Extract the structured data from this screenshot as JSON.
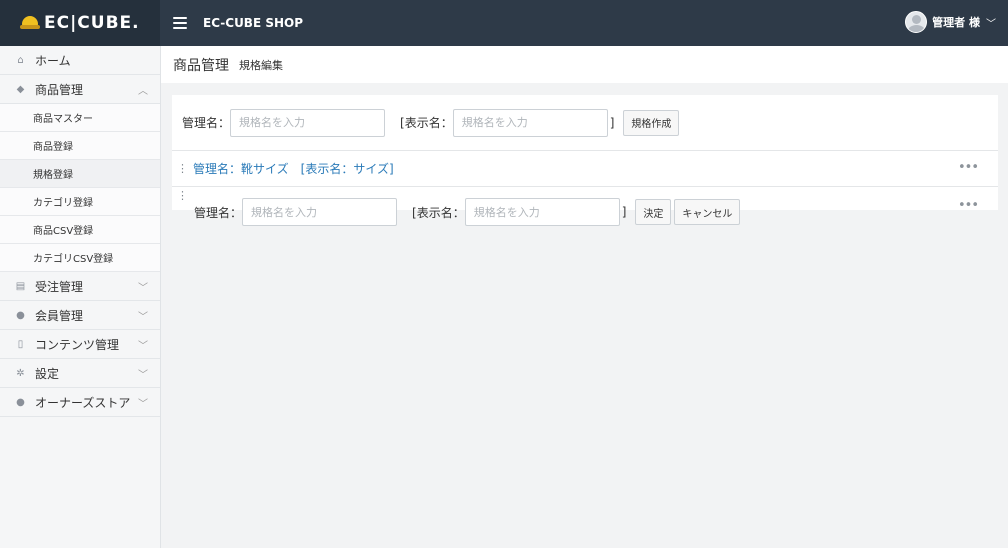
{
  "header": {
    "logo_text": "EC|CUBE.",
    "shop_name": "EC-CUBE SHOP",
    "user_name": "管理者 様",
    "user_chevron": "﹀"
  },
  "sidebar": {
    "items": [
      {
        "label": "ホーム",
        "icon": "home-icon",
        "glyph": "⌂"
      },
      {
        "label": "商品管理",
        "icon": "tag-icon",
        "glyph": "◆",
        "chevron": "︿"
      },
      {
        "label": "受注管理",
        "icon": "cart-icon",
        "glyph": "▤",
        "chevron": "﹀"
      },
      {
        "label": "会員管理",
        "icon": "users-icon",
        "glyph": "●",
        "chevron": "﹀"
      },
      {
        "label": "コンテンツ管理",
        "icon": "file-icon",
        "glyph": "▯",
        "chevron": "﹀"
      },
      {
        "label": "設定",
        "icon": "gear-icon",
        "glyph": "✲",
        "chevron": "﹀"
      },
      {
        "label": "オーナーズストア",
        "icon": "info-icon",
        "glyph": "●",
        "chevron": "﹀"
      }
    ],
    "sub_items": [
      {
        "label": "商品マスター"
      },
      {
        "label": "商品登録"
      },
      {
        "label": "規格登録"
      },
      {
        "label": "カテゴリ登録"
      },
      {
        "label": "商品CSV登録"
      },
      {
        "label": "カテゴリCSV登録"
      }
    ]
  },
  "page": {
    "title": "商品管理",
    "subtitle": "規格編集"
  },
  "create_form": {
    "name_label": "管理名：",
    "name_placeholder": "規格名を入力",
    "display_label": "[表示名：",
    "display_placeholder": "規格名を入力",
    "close_bracket": "]",
    "create_button": "規格作成"
  },
  "class_list": {
    "items": [
      {
        "text": "管理名：靴サイズ　[表示名：サイズ]"
      }
    ],
    "drag_glyph": "⋮",
    "more_glyph": "•••"
  },
  "edit_form": {
    "name_label": "管理名：",
    "name_placeholder": "規格名を入力",
    "display_label": "[表示名：",
    "display_placeholder": "規格名を入力",
    "close_bracket": "]",
    "confirm_button": "決定",
    "cancel_button": "キャンセル"
  }
}
